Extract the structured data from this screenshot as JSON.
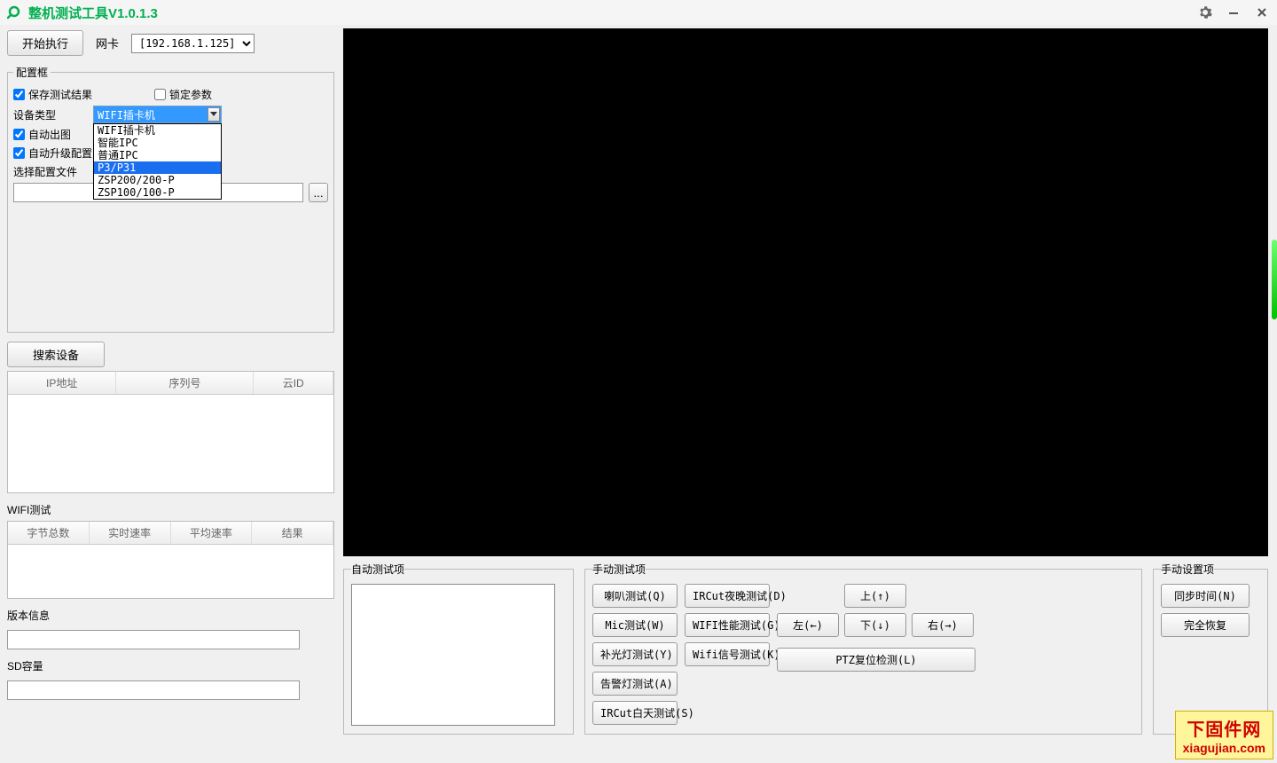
{
  "title": "整机测试工具V1.0.1.3",
  "toolbar": {
    "start_label": "开始执行",
    "net_label": "网卡",
    "net_value": "[192.168.1.125]"
  },
  "config": {
    "legend": "配置框",
    "save_result": "保存测试结果",
    "lock_params": "锁定参数",
    "device_type_label": "设备类型",
    "device_type_value": "WIFI插卡机",
    "device_type_options": [
      "WIFI插卡机",
      "智能IPC",
      "普通IPC",
      "P3/P31",
      "ZSP200/200-P",
      "ZSP100/100-P"
    ],
    "device_type_selected_index": 3,
    "auto_image": "自动出图",
    "auto_upgrade": "自动升级配置",
    "select_cfg_file": "选择配置文件",
    "browse": "..."
  },
  "search": {
    "btn": "搜索设备"
  },
  "device_table": {
    "headers": [
      "IP地址",
      "序列号",
      "云ID"
    ]
  },
  "wifi_test": {
    "label": "WIFI测试",
    "headers": [
      "字节总数",
      "实时速率",
      "平均速率",
      "结果"
    ]
  },
  "version": {
    "label": "版本信息"
  },
  "sd": {
    "label": "SD容量"
  },
  "auto_test": {
    "legend": "自动测试项"
  },
  "manual_test": {
    "legend": "手动测试项",
    "col1": [
      "喇叭测试(Q)",
      "Mic测试(W)",
      "补光灯测试(Y)",
      "告警灯测试(A)",
      "IRCut白天测试(S)"
    ],
    "col2": [
      "IRCut夜晚测试(D)",
      "WIFI性能测试(G)",
      "Wifi信号测试(K)"
    ],
    "dir": {
      "up": "上(↑)",
      "down": "下(↓)",
      "left": "左(←)",
      "right": "右(→)"
    },
    "ptz_reset": "PTZ复位检测(L)"
  },
  "manual_set": {
    "legend": "手动设置项",
    "sync_time": "同步时间(N)",
    "full_restore": "完全恢复"
  },
  "watermark": {
    "cn": "下固件网",
    "url": "xiagujian.com"
  }
}
